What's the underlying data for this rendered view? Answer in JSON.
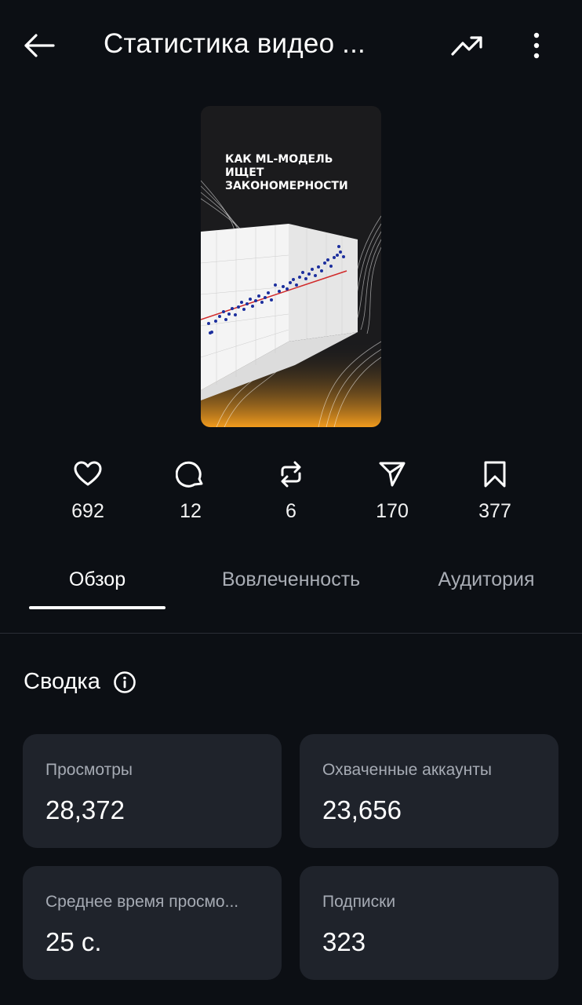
{
  "header": {
    "title": "Статистика видео ...",
    "back_icon": "arrow-left-icon",
    "trend_icon": "trending-up-icon",
    "more_icon": "more-vertical-icon"
  },
  "thumbnail": {
    "title": "КАК ML-МОДЕЛЬ ИЩЕТ ЗАКОНОМЕРНОСТИ"
  },
  "stats": [
    {
      "icon": "heart-icon",
      "value": "692"
    },
    {
      "icon": "comment-icon",
      "value": "12"
    },
    {
      "icon": "repost-icon",
      "value": "6"
    },
    {
      "icon": "send-icon",
      "value": "170"
    },
    {
      "icon": "bookmark-icon",
      "value": "377"
    }
  ],
  "tabs": [
    {
      "label": "Обзор",
      "active": true
    },
    {
      "label": "Вовлеченность",
      "active": false
    },
    {
      "label": "Аудитория",
      "active": false
    }
  ],
  "summary": {
    "title": "Сводка",
    "info_icon": "info-icon",
    "cards": [
      {
        "label": "Просмотры",
        "value": "28,372"
      },
      {
        "label": "Охваченные аккаунты",
        "value": "23,656"
      },
      {
        "label": "Среднее время просмо...",
        "value": "25 с."
      },
      {
        "label": "Подписки",
        "value": "323"
      }
    ]
  },
  "colors": {
    "background": "#0c0f14",
    "card": "#1f232b",
    "accent_orange": "#f29b1d",
    "trend_line": "#d12a2a",
    "points": "#1c2f9e"
  }
}
